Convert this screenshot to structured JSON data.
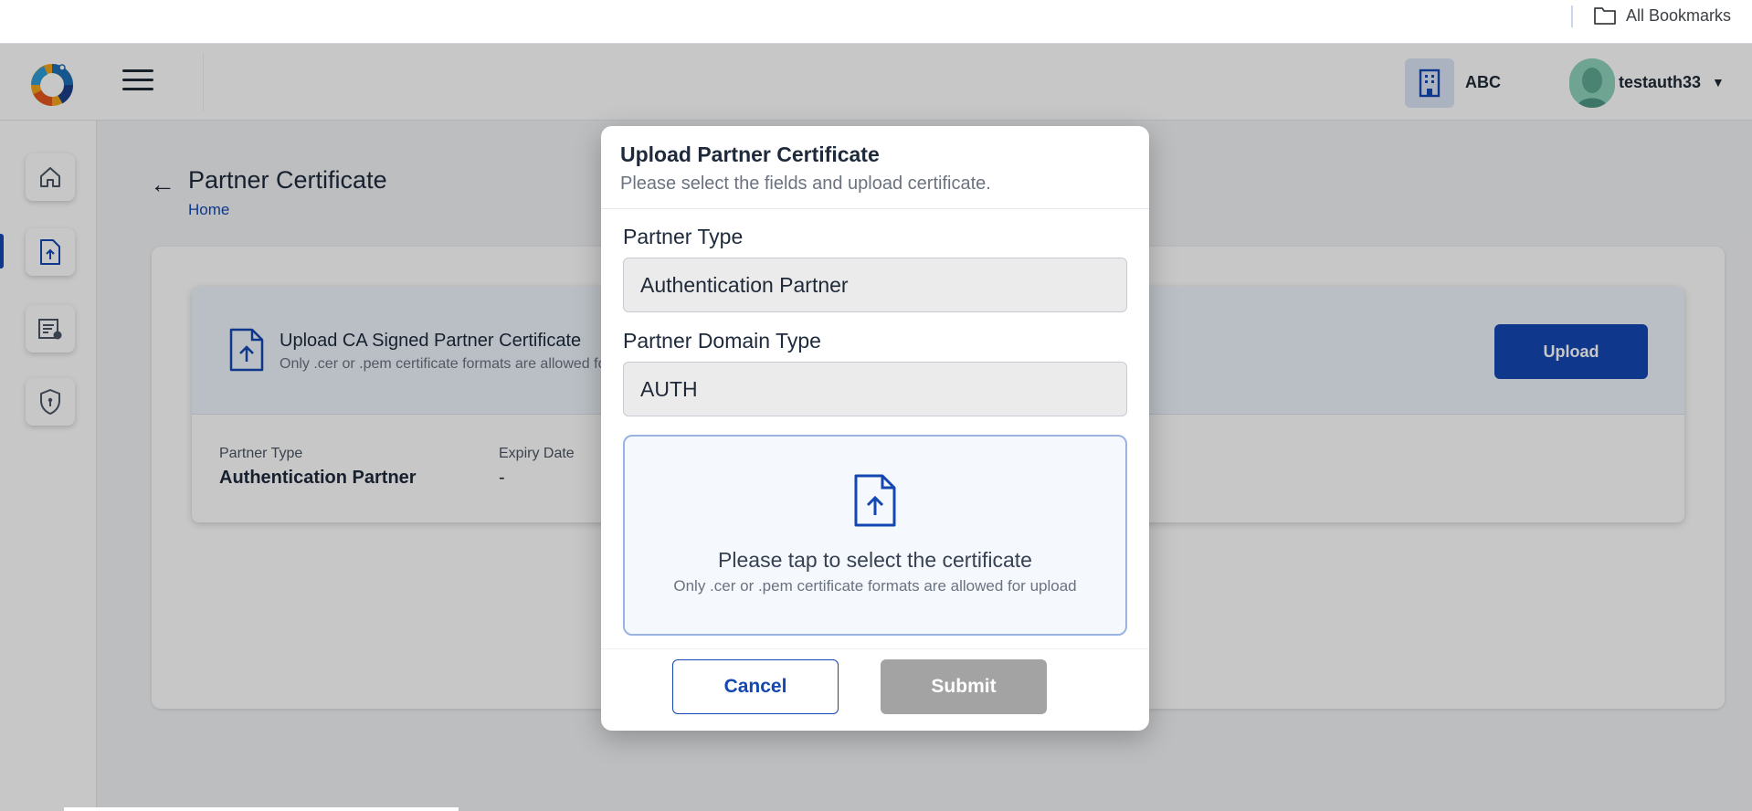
{
  "browser": {
    "bookmarks_label": "All Bookmarks"
  },
  "header": {
    "org_name": "ABC",
    "user_name": "testauth33",
    "user_menu_caret": "▼"
  },
  "sidebar": {
    "items": [
      {
        "icon": "home-icon"
      },
      {
        "icon": "upload-certificate-icon",
        "active": true
      },
      {
        "icon": "policy-document-icon"
      },
      {
        "icon": "shield-icon"
      }
    ]
  },
  "page": {
    "title": "Partner Certificate",
    "breadcrumb": "Home",
    "back_arrow": "←"
  },
  "certificate_card": {
    "heading": "Upload CA Signed Partner Certificate",
    "subtext": "Only .cer or .pem certificate formats are allowed for upload",
    "upload_button": "Upload",
    "partner_type_label": "Partner Type",
    "partner_type_value": "Authentication Partner",
    "expiry_date_label": "Expiry Date",
    "expiry_date_value": "-"
  },
  "modal": {
    "title": "Upload Partner Certificate",
    "subtitle": "Please select the fields and upload certificate.",
    "partner_type_label": "Partner Type",
    "partner_type_value": "Authentication Partner",
    "domain_type_label": "Partner Domain Type",
    "domain_type_value": "AUTH",
    "drop_zone_main": "Please tap to select the certificate",
    "drop_zone_sub": "Only .cer or .pem certificate formats are allowed for upload",
    "cancel_button": "Cancel",
    "submit_button": "Submit"
  },
  "colors": {
    "primary": "#1447b2",
    "disabled": "#a3a3a3",
    "overlay": "rgba(0,0,0,0.22)"
  }
}
